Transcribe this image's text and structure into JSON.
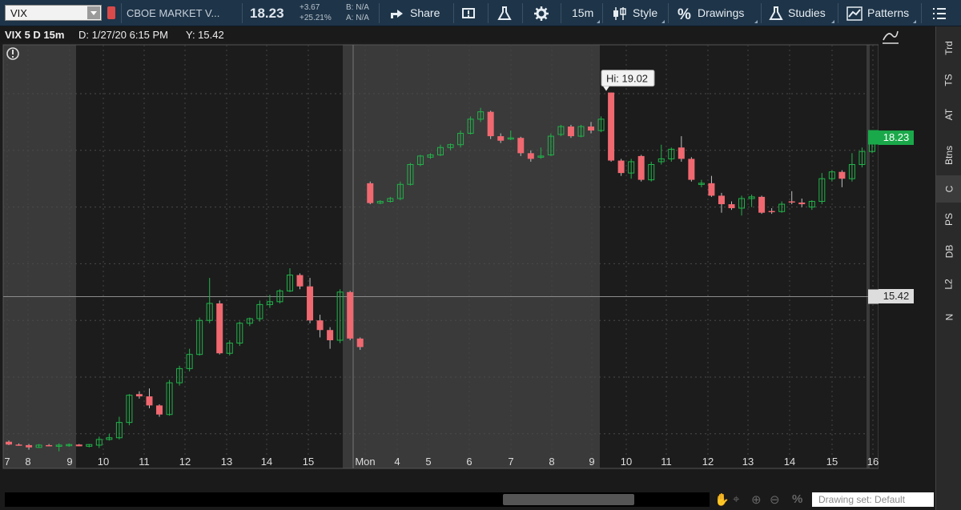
{
  "toolbar": {
    "symbol": "VIX",
    "description": "CBOE MARKET V...",
    "last_price": "18.23",
    "change": "+3.67",
    "change_pct": "+25.21%",
    "bid": "B: N/A",
    "ask": "A: N/A",
    "share_label": "Share",
    "timeframe_label": "15m",
    "style_label": "Style",
    "drawings_label": "Drawings",
    "studies_label": "Studies",
    "patterns_label": "Patterns"
  },
  "infobar": {
    "title": "VIX 5 D 15m",
    "date": "D: 1/27/20 6:15 PM",
    "y_value": "Y: 15.42"
  },
  "side_tabs": [
    "Trd",
    "TS",
    "AT",
    "Btns",
    "C",
    "PS",
    "DB",
    "L2",
    "N"
  ],
  "bottom": {
    "drawing_set": "Drawing set: Default"
  },
  "colors": {
    "up": "#22b34a",
    "down": "#f06870",
    "last_price_badge": "#1aa94a",
    "crosshair_badge": "#dddddd"
  },
  "chart_data": {
    "type": "candlestick",
    "ylim": [
      12.35,
      19.9
    ],
    "y_ticks": [
      13,
      14,
      15,
      16,
      17,
      18,
      19
    ],
    "x_tick_labels": [
      "7",
      "8",
      "9",
      "10",
      "11",
      "12",
      "13",
      "14",
      "15",
      "Mon",
      "4",
      "5",
      "6",
      "7",
      "8",
      "9",
      "10",
      "11",
      "12",
      "13",
      "14",
      "15",
      "16"
    ],
    "last_price_label": "18.23",
    "crosshair_label": "15.42",
    "crosshair_value": 15.42,
    "high_annotation": "Hi: 19.02",
    "high_value": 19.02,
    "candles": [
      {
        "o": 12.86,
        "h": 12.88,
        "l": 12.8,
        "c": 12.81
      },
      {
        "o": 12.81,
        "h": 12.83,
        "l": 12.79,
        "c": 12.8
      },
      {
        "o": 12.8,
        "h": 12.82,
        "l": 12.72,
        "c": 12.76
      },
      {
        "o": 12.76,
        "h": 12.82,
        "l": 12.75,
        "c": 12.8
      },
      {
        "o": 12.8,
        "h": 12.82,
        "l": 12.78,
        "c": 12.79
      },
      {
        "o": 12.79,
        "h": 12.83,
        "l": 12.69,
        "c": 12.8
      },
      {
        "o": 12.79,
        "h": 12.83,
        "l": 12.77,
        "c": 12.81
      },
      {
        "o": 12.81,
        "h": 12.82,
        "l": 12.78,
        "c": 12.78
      },
      {
        "o": 12.78,
        "h": 12.82,
        "l": 12.76,
        "c": 12.81
      },
      {
        "o": 12.8,
        "h": 12.95,
        "l": 12.75,
        "c": 12.9
      },
      {
        "o": 12.9,
        "h": 13.0,
        "l": 12.88,
        "c": 12.93
      },
      {
        "o": 12.93,
        "h": 13.3,
        "l": 12.9,
        "c": 13.2
      },
      {
        "o": 13.2,
        "h": 13.7,
        "l": 13.15,
        "c": 13.68
      },
      {
        "o": 13.7,
        "h": 13.75,
        "l": 13.62,
        "c": 13.66
      },
      {
        "o": 13.66,
        "h": 13.8,
        "l": 13.45,
        "c": 13.5
      },
      {
        "o": 13.5,
        "h": 13.52,
        "l": 13.3,
        "c": 13.34
      },
      {
        "o": 13.34,
        "h": 13.95,
        "l": 13.32,
        "c": 13.9
      },
      {
        "o": 13.9,
        "h": 14.2,
        "l": 13.85,
        "c": 14.15
      },
      {
        "o": 14.15,
        "h": 14.5,
        "l": 14.1,
        "c": 14.4
      },
      {
        "o": 14.4,
        "h": 15.05,
        "l": 14.38,
        "c": 15.0
      },
      {
        "o": 15.0,
        "h": 15.75,
        "l": 14.95,
        "c": 15.3
      },
      {
        "o": 15.3,
        "h": 15.35,
        "l": 14.4,
        "c": 14.42
      },
      {
        "o": 14.42,
        "h": 14.65,
        "l": 14.38,
        "c": 14.6
      },
      {
        "o": 14.6,
        "h": 14.98,
        "l": 14.55,
        "c": 14.95
      },
      {
        "o": 14.95,
        "h": 15.05,
        "l": 14.9,
        "c": 15.03
      },
      {
        "o": 15.03,
        "h": 15.35,
        "l": 14.98,
        "c": 15.28
      },
      {
        "o": 15.28,
        "h": 15.45,
        "l": 15.22,
        "c": 15.33
      },
      {
        "o": 15.33,
        "h": 15.55,
        "l": 15.3,
        "c": 15.52
      },
      {
        "o": 15.52,
        "h": 15.92,
        "l": 15.5,
        "c": 15.8
      },
      {
        "o": 15.8,
        "h": 15.83,
        "l": 15.55,
        "c": 15.6
      },
      {
        "o": 15.6,
        "h": 15.75,
        "l": 14.95,
        "c": 15.0
      },
      {
        "o": 15.0,
        "h": 15.1,
        "l": 14.7,
        "c": 14.83
      },
      {
        "o": 14.83,
        "h": 14.88,
        "l": 14.5,
        "c": 14.65
      },
      {
        "o": 14.65,
        "h": 15.55,
        "l": 14.6,
        "c": 15.5
      },
      {
        "o": 15.5,
        "h": 15.52,
        "l": 14.65,
        "c": 14.68
      },
      {
        "o": 14.68,
        "h": 14.7,
        "l": 14.48,
        "c": 14.53
      },
      {
        "o": 17.42,
        "h": 17.45,
        "l": 17.05,
        "c": 17.07
      },
      {
        "o": 17.07,
        "h": 17.12,
        "l": 17.05,
        "c": 17.1
      },
      {
        "o": 17.1,
        "h": 17.18,
        "l": 17.08,
        "c": 17.15
      },
      {
        "o": 17.15,
        "h": 17.45,
        "l": 17.12,
        "c": 17.4
      },
      {
        "o": 17.4,
        "h": 17.78,
        "l": 17.38,
        "c": 17.75
      },
      {
        "o": 17.75,
        "h": 17.92,
        "l": 17.72,
        "c": 17.9
      },
      {
        "o": 17.88,
        "h": 17.95,
        "l": 17.85,
        "c": 17.92
      },
      {
        "o": 17.92,
        "h": 18.1,
        "l": 17.9,
        "c": 18.05
      },
      {
        "o": 18.05,
        "h": 18.12,
        "l": 18.0,
        "c": 18.1
      },
      {
        "o": 18.1,
        "h": 18.35,
        "l": 18.05,
        "c": 18.3
      },
      {
        "o": 18.3,
        "h": 18.6,
        "l": 18.28,
        "c": 18.55
      },
      {
        "o": 18.55,
        "h": 18.75,
        "l": 18.5,
        "c": 18.68
      },
      {
        "o": 18.68,
        "h": 18.7,
        "l": 18.2,
        "c": 18.25
      },
      {
        "o": 18.25,
        "h": 18.3,
        "l": 18.13,
        "c": 18.17
      },
      {
        "o": 18.2,
        "h": 18.35,
        "l": 18.18,
        "c": 18.22
      },
      {
        "o": 18.22,
        "h": 18.24,
        "l": 17.9,
        "c": 17.95
      },
      {
        "o": 17.95,
        "h": 18.0,
        "l": 17.8,
        "c": 17.85
      },
      {
        "o": 17.88,
        "h": 18.05,
        "l": 17.85,
        "c": 17.9
      },
      {
        "o": 17.92,
        "h": 18.3,
        "l": 17.9,
        "c": 18.25
      },
      {
        "o": 18.28,
        "h": 18.45,
        "l": 18.25,
        "c": 18.42
      },
      {
        "o": 18.42,
        "h": 18.45,
        "l": 18.22,
        "c": 18.25
      },
      {
        "o": 18.25,
        "h": 18.45,
        "l": 18.23,
        "c": 18.42
      },
      {
        "o": 18.42,
        "h": 18.5,
        "l": 18.3,
        "c": 18.35
      },
      {
        "o": 18.35,
        "h": 18.6,
        "l": 18.32,
        "c": 18.55
      },
      {
        "o": 19.02,
        "h": 19.02,
        "l": 17.8,
        "c": 17.82
      },
      {
        "o": 17.82,
        "h": 17.85,
        "l": 17.55,
        "c": 17.6
      },
      {
        "o": 17.6,
        "h": 17.85,
        "l": 17.5,
        "c": 17.8
      },
      {
        "o": 17.9,
        "h": 17.92,
        "l": 17.45,
        "c": 17.48
      },
      {
        "o": 17.48,
        "h": 17.8,
        "l": 17.45,
        "c": 17.75
      },
      {
        "o": 17.8,
        "h": 18.1,
        "l": 17.75,
        "c": 17.85
      },
      {
        "o": 17.85,
        "h": 18.05,
        "l": 17.8,
        "c": 18.02
      },
      {
        "o": 18.05,
        "h": 18.25,
        "l": 17.8,
        "c": 17.85
      },
      {
        "o": 17.85,
        "h": 17.88,
        "l": 17.45,
        "c": 17.48
      },
      {
        "o": 17.42,
        "h": 17.48,
        "l": 17.35,
        "c": 17.42
      },
      {
        "o": 17.42,
        "h": 17.55,
        "l": 17.18,
        "c": 17.2
      },
      {
        "o": 17.2,
        "h": 17.25,
        "l": 16.9,
        "c": 17.05
      },
      {
        "o": 17.05,
        "h": 17.1,
        "l": 16.95,
        "c": 16.98
      },
      {
        "o": 16.98,
        "h": 17.2,
        "l": 16.85,
        "c": 17.15
      },
      {
        "o": 17.15,
        "h": 17.22,
        "l": 17.0,
        "c": 17.18
      },
      {
        "o": 17.18,
        "h": 17.2,
        "l": 16.88,
        "c": 16.9
      },
      {
        "o": 16.93,
        "h": 16.98,
        "l": 16.88,
        "c": 16.92
      },
      {
        "o": 16.92,
        "h": 17.1,
        "l": 16.9,
        "c": 17.05
      },
      {
        "o": 17.1,
        "h": 17.28,
        "l": 17.05,
        "c": 17.08
      },
      {
        "o": 17.08,
        "h": 17.15,
        "l": 17.0,
        "c": 17.05
      },
      {
        "o": 17.0,
        "h": 17.12,
        "l": 16.95,
        "c": 17.1
      },
      {
        "o": 17.1,
        "h": 17.6,
        "l": 17.05,
        "c": 17.5
      },
      {
        "o": 17.5,
        "h": 17.65,
        "l": 17.45,
        "c": 17.62
      },
      {
        "o": 17.62,
        "h": 17.65,
        "l": 17.35,
        "c": 17.5
      },
      {
        "o": 17.5,
        "h": 17.95,
        "l": 17.45,
        "c": 17.75
      },
      {
        "o": 17.75,
        "h": 18.05,
        "l": 17.7,
        "c": 17.98
      },
      {
        "o": 17.98,
        "h": 18.25,
        "l": 17.95,
        "c": 18.23
      }
    ]
  }
}
